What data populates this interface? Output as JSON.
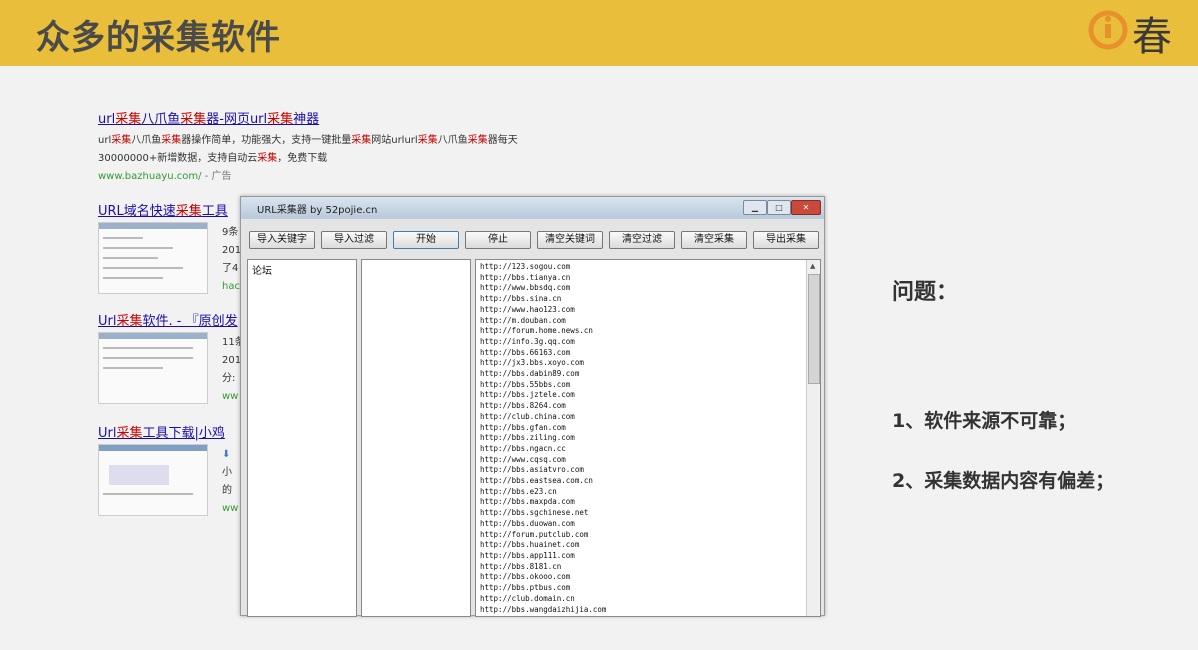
{
  "slide": {
    "title": "众多的采集软件",
    "logo_text": "春"
  },
  "ad": {
    "title_parts": [
      "url",
      "采集",
      "八爪鱼",
      "采集",
      "器-网页url",
      "采集",
      "神器"
    ],
    "desc_line1_parts": [
      "url",
      "采集",
      "八爪鱼",
      "采集",
      "器操作简单，功能强大，支持一键批量",
      "采集",
      "网站urlurl",
      "采集",
      "八爪鱼",
      "采集",
      "器每天"
    ],
    "desc_line2_parts": [
      "30000000+新增数据，支持自动云",
      "采集",
      "，免费下载"
    ],
    "url": "www.bazhuayu.com/",
    "ad_label": "- 广告"
  },
  "results": [
    {
      "title_parts": [
        "URL域名快速",
        "采集",
        "工具"
      ],
      "snippet": [
        "9条",
        "201",
        "了4"
      ],
      "green": "hac"
    },
    {
      "title_parts": [
        "Url",
        "采集",
        "软件. - 『原创发"
      ],
      "snippet": [
        "11条",
        "201",
        "分:"
      ],
      "green": "ww"
    },
    {
      "title_parts": [
        "Url",
        "采集",
        "工具下载|小鸡"
      ],
      "snippet": [
        "小",
        "的"
      ],
      "green": "ww"
    }
  ],
  "window": {
    "title": "URL采集器 by 52pojie.cn",
    "buttons": [
      "导入关键字",
      "导入过滤",
      "开始",
      "停止",
      "清空关键词",
      "清空过滤",
      "清空采集",
      "导出采集"
    ],
    "list1_label": "论坛",
    "urls": [
      "http://123.sogou.com",
      "http://bbs.tianya.cn",
      "http://www.bbsdq.com",
      "http://bbs.sina.cn",
      "http://www.hao123.com",
      "http://m.douban.com",
      "http://forum.home.news.cn",
      "http://info.3g.qq.com",
      "http://bbs.66163.com",
      "http://jx3.bbs.xoyo.com",
      "http://bbs.dabin89.com",
      "http://bbs.55bbs.com",
      "http://bbs.jztele.com",
      "http://bbs.8264.com",
      "http://club.china.com",
      "http://bbs.gfan.com",
      "http://bbs.ziling.com",
      "http://bbs.ngacn.cc",
      "http://www.cqsq.com",
      "http://bbs.asiatvro.com",
      "http://bbs.eastsea.com.cn",
      "http://bbs.e23.cn",
      "http://bbs.maxpda.com",
      "http://bbs.sgchinese.net",
      "http://bbs.duowan.com",
      "http://forum.putclub.com",
      "http://bbs.huainet.com",
      "http://bbs.app111.com",
      "http://bbs.8181.cn",
      "http://bbs.okooo.com",
      "http://bbs.ptbus.com",
      "http://club.domain.cn",
      "http://bbs.wangdaizhijia.com"
    ]
  },
  "questions": {
    "heading": "问题：",
    "items": [
      "1、软件来源不可靠；",
      "2、采集数据内容有偏差；"
    ]
  },
  "colors": {
    "banner": "#e8be3a",
    "logo_orange": "#e8902a",
    "link": "#1a0dab",
    "highlight": "#c00"
  }
}
